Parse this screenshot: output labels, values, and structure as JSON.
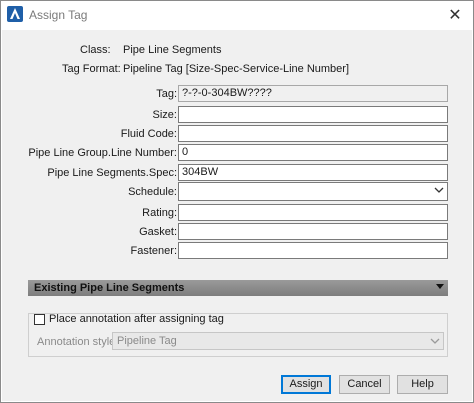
{
  "window": {
    "title": "Assign Tag",
    "close_glyph": "✕",
    "app_icon": "autodesk-plant-icon"
  },
  "info": {
    "class_label": "Class:",
    "class_value": "Pipe Line Segments",
    "format_label": "Tag Format:",
    "format_value": "Pipeline Tag [Size-Spec-Service-Line Number]"
  },
  "fields": {
    "tag": {
      "label": "Tag:",
      "value": "?-?-0-304BW????"
    },
    "size": {
      "label": "Size:",
      "value": ""
    },
    "fluid_code": {
      "label": "Fluid Code:",
      "value": ""
    },
    "line_number": {
      "label": "Pipe Line Group.Line Number:",
      "value": "0"
    },
    "spec": {
      "label": "Pipe Line Segments.Spec:",
      "value": "304BW"
    },
    "schedule": {
      "label": "Schedule:",
      "value": ""
    },
    "rating": {
      "label": "Rating:",
      "value": ""
    },
    "gasket": {
      "label": "Gasket:",
      "value": ""
    },
    "fastener": {
      "label": "Fastener:",
      "value": ""
    }
  },
  "existing_section": {
    "label": "Existing Pipe Line Segments"
  },
  "annotation": {
    "checkbox_label": "Place annotation after assigning tag",
    "checked": false,
    "style_label": "Annotation style:",
    "style_value": "Pipeline Tag"
  },
  "buttons": {
    "assign": "Assign",
    "cancel": "Cancel",
    "help": "Help"
  }
}
